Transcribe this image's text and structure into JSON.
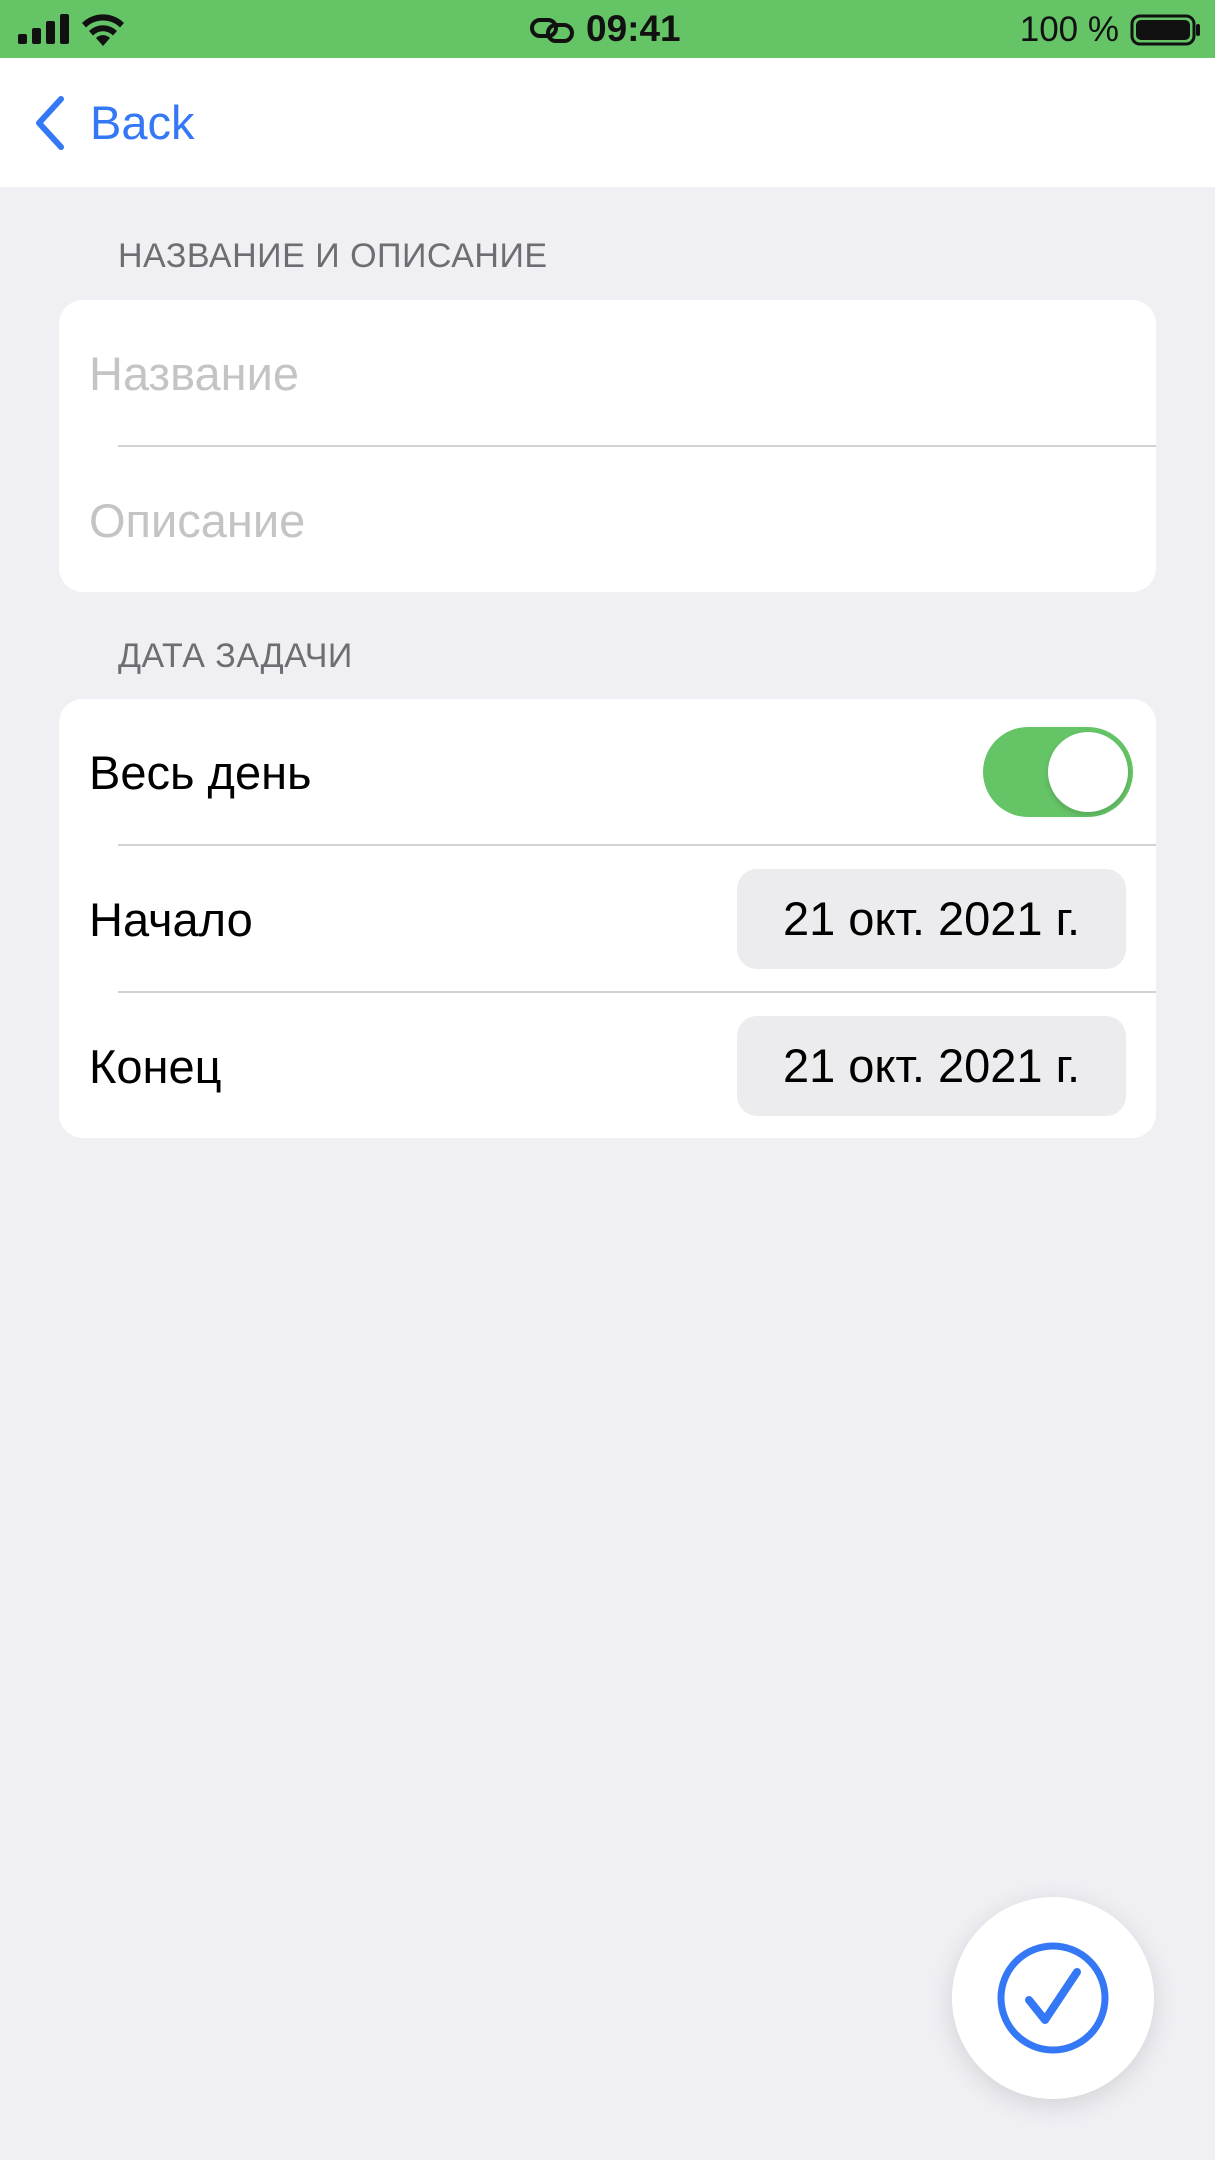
{
  "status_bar": {
    "time": "09:41",
    "battery_text": "100 %",
    "signal_icon": "cellular-signal-icon",
    "wifi_icon": "wifi-icon",
    "link_icon": "link-icon",
    "battery_icon": "battery-full-icon"
  },
  "nav": {
    "back_label": "Back",
    "back_icon": "chevron-left-icon"
  },
  "section_name": {
    "header": "НАЗВАНИЕ И ОПИСАНИЕ",
    "title_field": {
      "value": "",
      "placeholder": "Название"
    },
    "description_field": {
      "value": "",
      "placeholder": "Описание"
    }
  },
  "section_date": {
    "header": "ДАТА ЗАДАЧИ",
    "all_day": {
      "label": "Весь день",
      "enabled": true
    },
    "start": {
      "label": "Начало",
      "value": "21 окт. 2021 г."
    },
    "end": {
      "label": "Конец",
      "value": "21 окт. 2021 г."
    }
  },
  "fab": {
    "icon": "checkmark-circle-icon"
  },
  "colors": {
    "accent": "#3478f6",
    "toggle_on": "#65c466",
    "status_bar": "#65c466",
    "background": "#efeff4"
  }
}
